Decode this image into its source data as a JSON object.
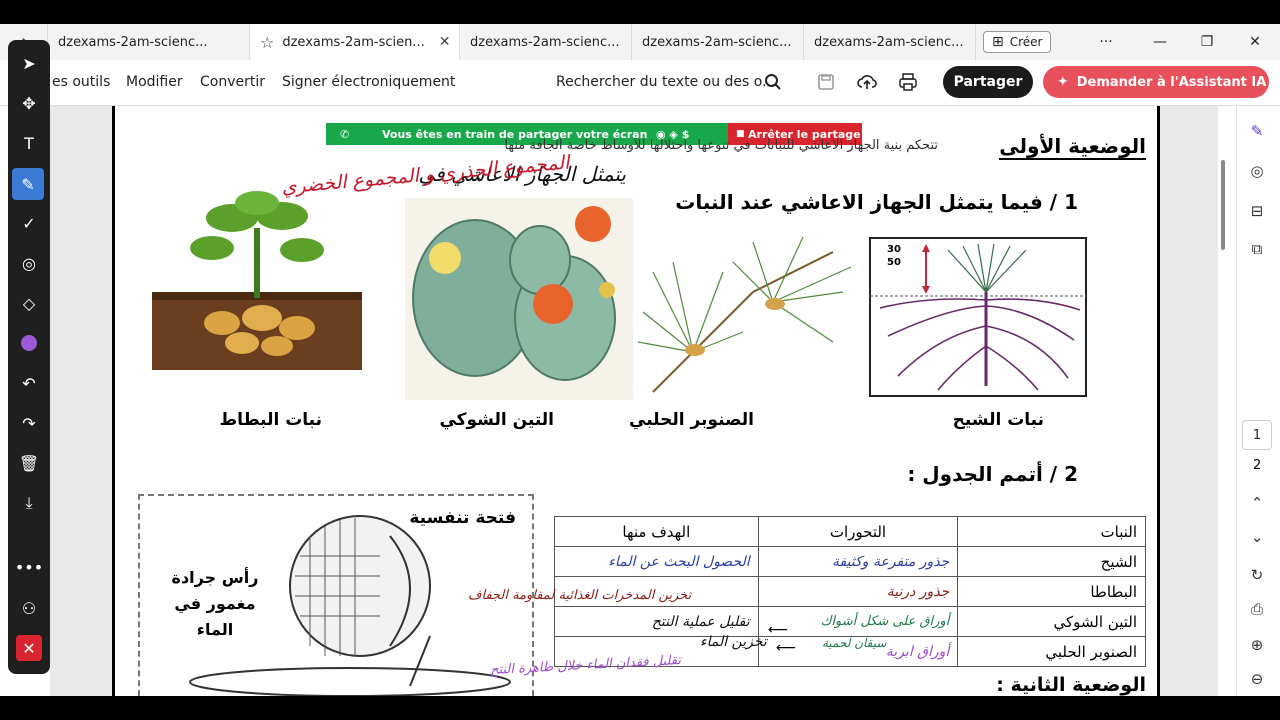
{
  "browser": {
    "tabs": [
      {
        "label": "dzexams-2am-scienc..."
      },
      {
        "label": "dzexams-2am-scien..."
      },
      {
        "label": "dzexams-2am-scienc..."
      },
      {
        "label": "dzexams-2am-scienc..."
      },
      {
        "label": "dzexams-2am-scienc..."
      }
    ],
    "new_tab_label": "Créer",
    "window_controls": {
      "more": "···",
      "minimize": "—",
      "restore": "❐",
      "close": "✕"
    }
  },
  "toolbar": {
    "tools_label": "es outils",
    "edit_label": "Modifier",
    "convert_label": "Convertir",
    "sign_label": "Signer électroniquement",
    "search_placeholder": "Rechercher du texte ou des o...",
    "share_label": "Partager",
    "ai_label": "Demander à l'Assistant IA"
  },
  "screen_share": {
    "message": "Vous êtes en train de partager votre écran",
    "stop_label": "Arrêter le partage"
  },
  "page_nav": {
    "pages": [
      "1",
      "2"
    ],
    "current": "1"
  },
  "document": {
    "situation1_title": "الوضعية الأولى",
    "situation1_intro": "تتحكم بنية الجهاز الاعاشي للنباتات في تنوعها واحتلالها للأوساط خاصة الجافة منها",
    "handwritten_line1": "يتمثل الجهاز الاعاشي في",
    "handwritten_line2": "المجموع الجذري و المجموع الخضري",
    "q1": "1 / فيما يتمثل الجهاز الاعاشي عند النبات",
    "plant_labels": [
      "نبات البطاط",
      "التين الشوكي",
      "الصنوبر الحلبي",
      "نبات الشيح"
    ],
    "plant_illustration_numbers": [
      "30",
      "50"
    ],
    "q2": "2 / أتمم الجدول :",
    "table": {
      "headers": [
        "النبات",
        "التحورات",
        "الهدف منها"
      ],
      "rows": [
        {
          "plant": "الشيح",
          "change": "جذور متفرعة وكثيفة",
          "goal": "الحصول البحث عن الماء"
        },
        {
          "plant": "البطاطا",
          "change": "جذور درنية",
          "goal": ""
        },
        {
          "plant": "التين الشوكي",
          "change": "أوراق على شكل أشواك",
          "goal": "تقليل عملية النتح"
        },
        {
          "plant": "الصنوبر الحلبي",
          "change": "أوراق ابرية",
          "goal": ""
        }
      ],
      "extra_notes": {
        "potato_goal": "تخزين المدخرات الغذائية لمقاومة الجفاف",
        "cactus_stem": "سيقان لحمية",
        "cactus_goal2": "تخزين الماء",
        "pine_goal": "تقليل فقدان الماء خلال ظاهرة النتح"
      }
    },
    "diagram_title": "فتحة تنفسية",
    "diagram_caption": "رأس جرادة مغمور في الماء",
    "situation2_title": "الوضعية الثانية :"
  }
}
